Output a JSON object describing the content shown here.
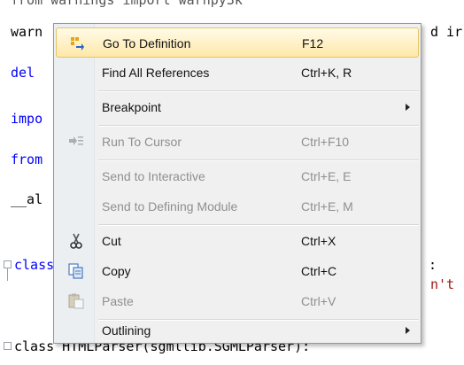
{
  "code": {
    "lines": [
      "from warnings import warnpy3k",
      "warn",
      "d ir",
      "del",
      "impo",
      "from",
      "__al",
      "class",
      ":",
      "n't",
      "class HTMLParser(sgmllib.SGMLParser):"
    ]
  },
  "menu": {
    "items": [
      {
        "label": "Go To Definition",
        "shortcut": "F12",
        "icon": "go-to-definition-icon"
      },
      {
        "label": "Find All References",
        "shortcut": "Ctrl+K, R"
      },
      {
        "label": "Breakpoint",
        "submenu": true
      },
      {
        "label": "Run To Cursor",
        "shortcut": "Ctrl+F10",
        "icon": "run-to-cursor-icon"
      },
      {
        "label": "Send to Interactive",
        "shortcut": "Ctrl+E, E"
      },
      {
        "label": "Send to Defining Module",
        "shortcut": "Ctrl+E, M"
      },
      {
        "label": "Cut",
        "shortcut": "Ctrl+X",
        "icon": "scissors-icon"
      },
      {
        "label": "Copy",
        "shortcut": "Ctrl+C",
        "icon": "copy-icon"
      },
      {
        "label": "Paste",
        "shortcut": "Ctrl+V",
        "icon": "paste-icon"
      },
      {
        "label": "Outlining",
        "submenu": true
      }
    ]
  },
  "colors": {
    "keyword": "#0000ff",
    "hover_bg": "#ffe8a8",
    "hover_border": "#e5c365",
    "disabled_text": "#8f8f8f"
  }
}
